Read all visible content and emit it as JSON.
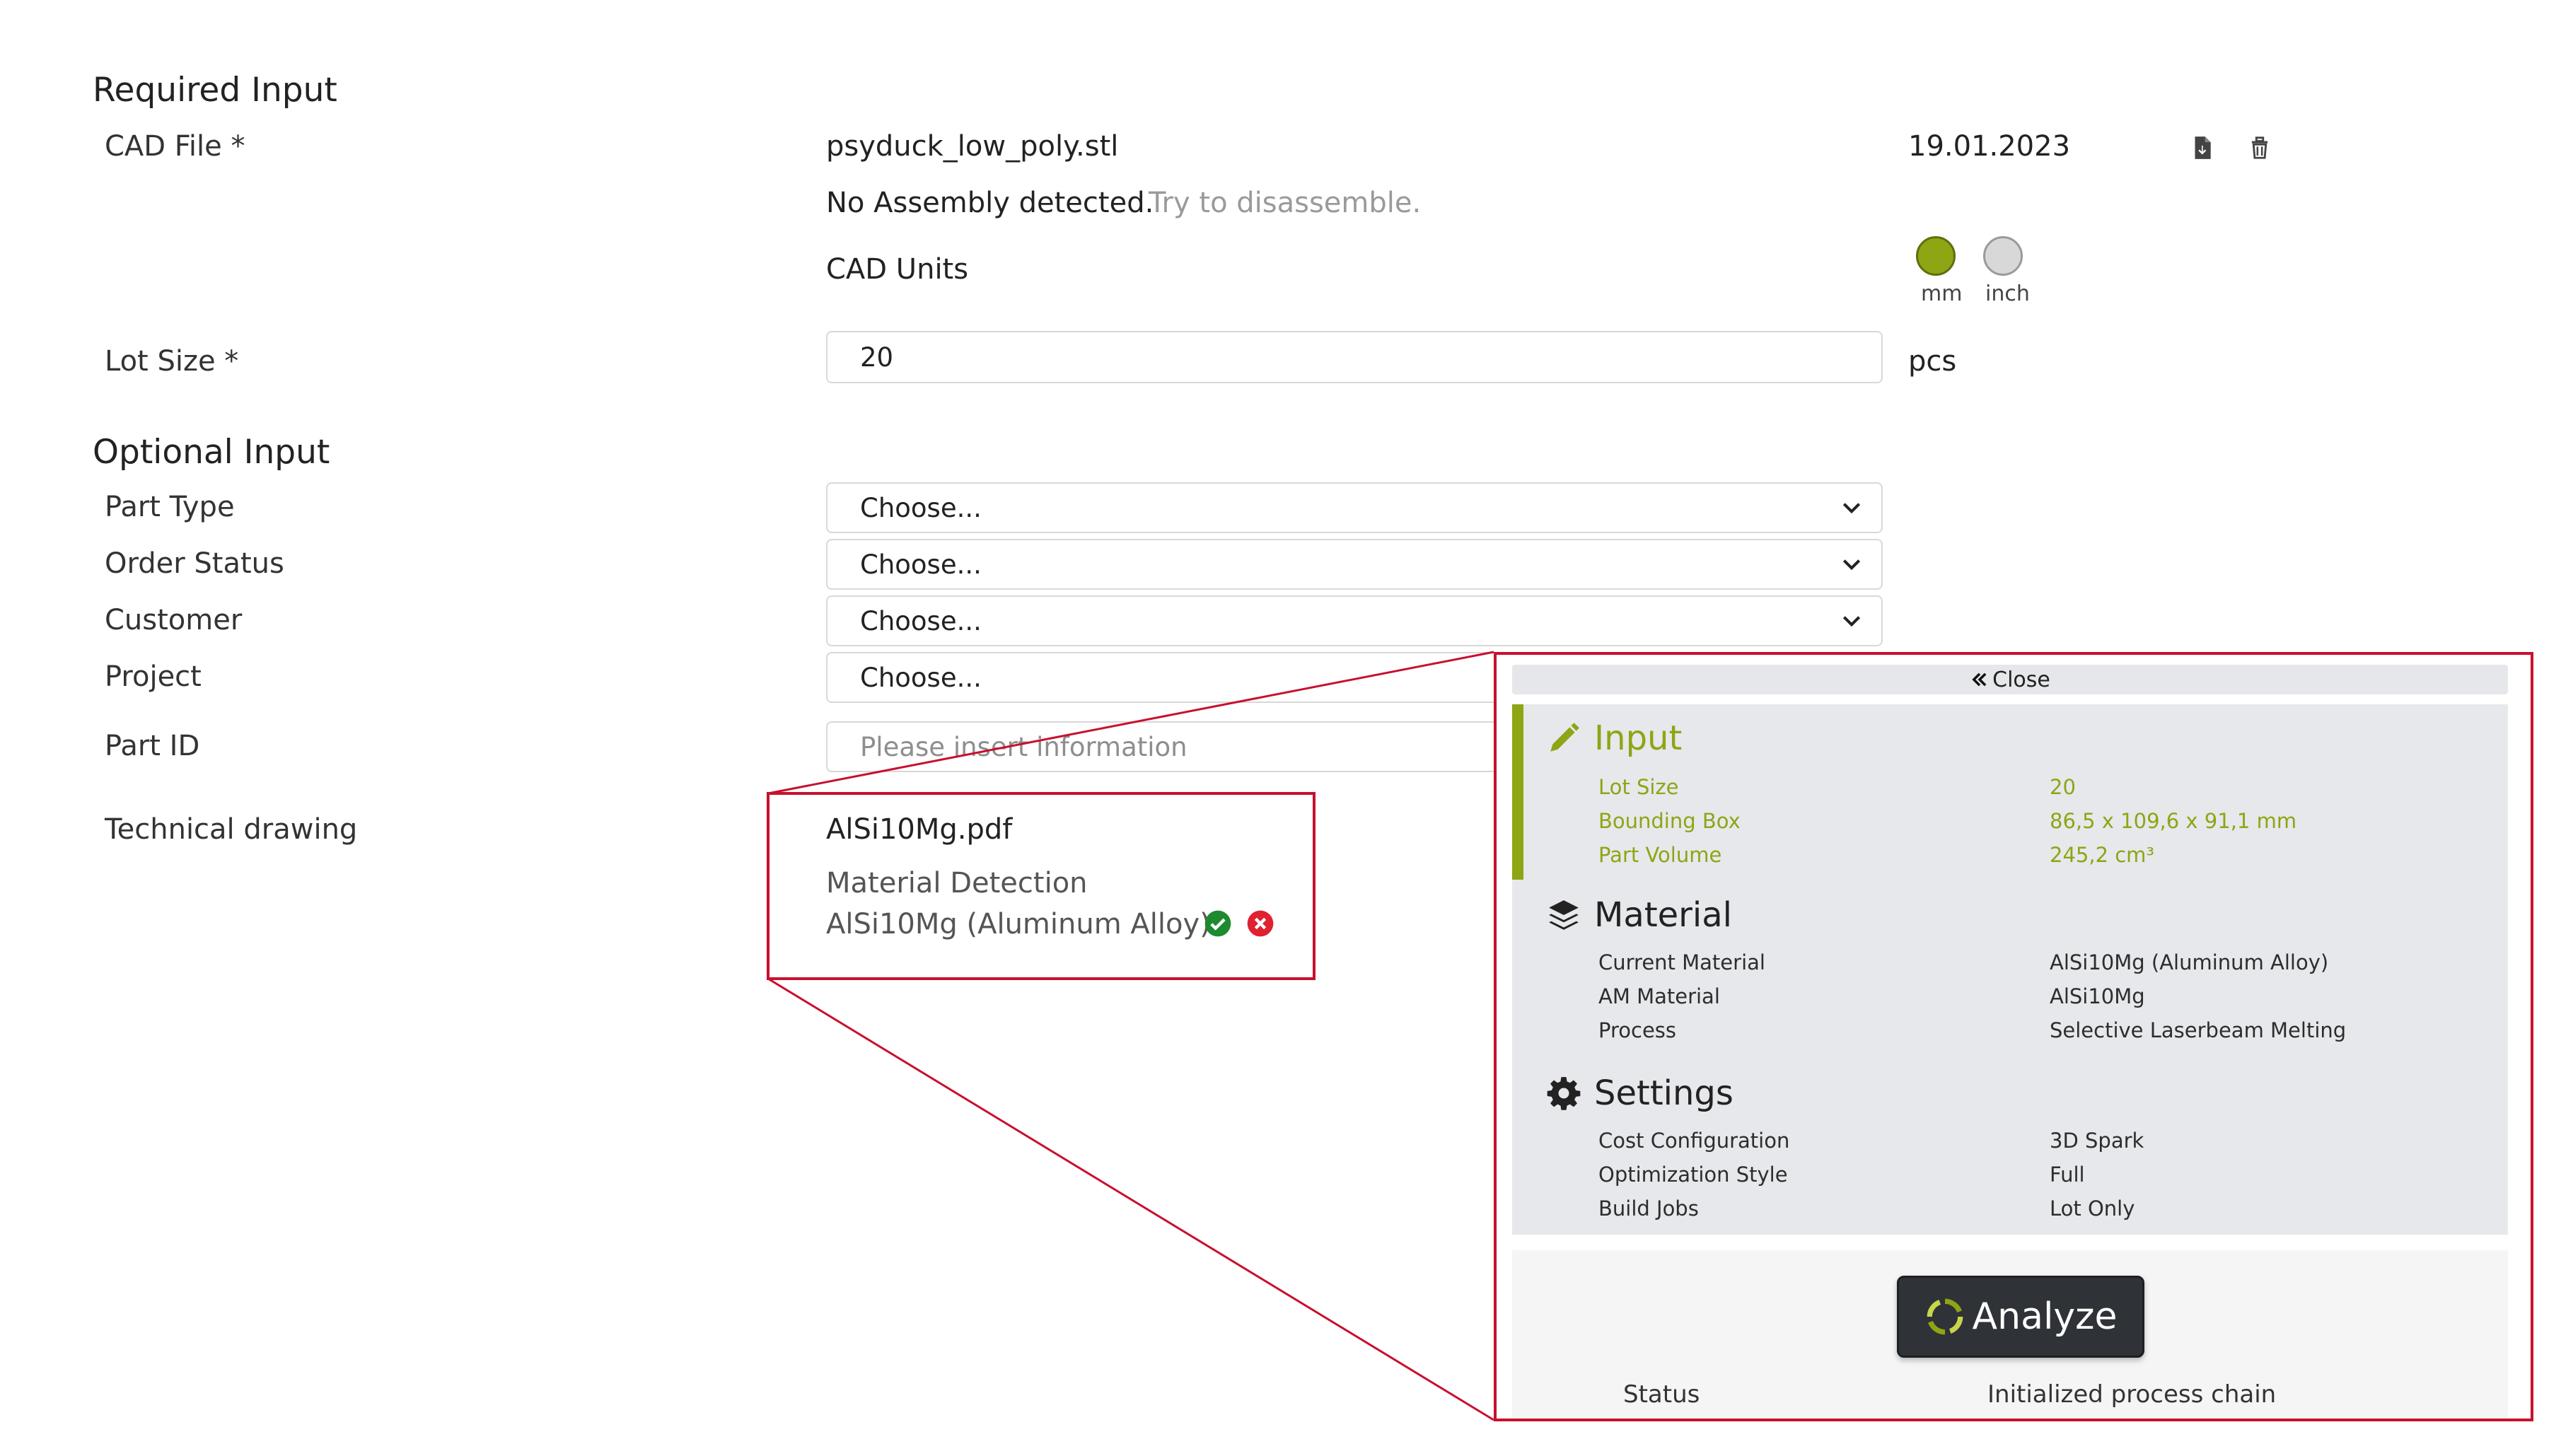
{
  "required": {
    "title": "Required Input",
    "cad_label": "CAD File *",
    "cad_filename": "psyduck_low_poly.stl",
    "cad_date": "19.01.2023",
    "assembly_text": "No Assembly detected.",
    "assembly_link": "Try to disassemble.",
    "cad_units_label": "CAD Units",
    "units": [
      {
        "label": "mm",
        "selected": true
      },
      {
        "label": "inch",
        "selected": false
      }
    ],
    "lot_label": "Lot Size *",
    "lot_value": "20",
    "lot_unit": "pcs"
  },
  "optional": {
    "title": "Optional Input",
    "part_type_label": "Part Type",
    "part_type_value": "Choose...",
    "order_status_label": "Order Status",
    "order_status_value": "Choose...",
    "customer_label": "Customer",
    "customer_value": "Choose...",
    "project_label": "Project",
    "project_value": "Choose...",
    "part_id_label": "Part ID",
    "part_id_placeholder": "Please insert information",
    "drawing_label": "Technical drawing",
    "drawing_file": "AlSi10Mg.pdf",
    "material_detection_title": "Material Detection",
    "material_detection_value": "AlSi10Mg (Aluminum Alloy)"
  },
  "panel": {
    "close_label": "Close",
    "input": {
      "title": "Input",
      "rows": [
        {
          "key": "Lot Size",
          "value": "20"
        },
        {
          "key": "Bounding Box",
          "value": "86,5 x 109,6 x 91,1  mm"
        },
        {
          "key": "Part Volume",
          "value": "245,2 cm³"
        }
      ]
    },
    "material": {
      "title": "Material",
      "rows": [
        {
          "key": "Current Material",
          "value": "AlSi10Mg (Aluminum Alloy)"
        },
        {
          "key": "AM Material",
          "value": "AlSi10Mg"
        },
        {
          "key": "Process",
          "value": "Selective Laserbeam Melting"
        }
      ]
    },
    "settings": {
      "title": "Settings",
      "rows": [
        {
          "key": "Cost Configuration",
          "value": "3D Spark"
        },
        {
          "key": "Optimization Style",
          "value": "Full"
        },
        {
          "key": "Build Jobs",
          "value": "Lot Only"
        }
      ]
    },
    "analyze_label": "Analyze",
    "status_label": "Status",
    "status_value": "Initialized process chain"
  },
  "colors": {
    "accent": "#8ea514",
    "highlight": "#c8102e",
    "confirm": "#1e8a2e",
    "reject": "#e0212f"
  }
}
